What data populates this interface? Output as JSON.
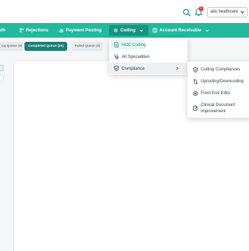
{
  "header": {
    "tenant_selected": "abc healthcare",
    "notification_count": "1"
  },
  "nav": {
    "items": [
      {
        "label": "uth"
      },
      {
        "label": "Rejections"
      },
      {
        "label": "Payment Posting"
      },
      {
        "label": "Coding"
      },
      {
        "label": "Account Receivable"
      }
    ]
  },
  "subtabs": {
    "items": [
      {
        "label": "ing Queue (0)"
      },
      {
        "label": "Completed Queue (20)"
      },
      {
        "label": "Failed Queue (0)"
      }
    ]
  },
  "coding_menu": {
    "items": [
      {
        "label": "HCC Coding"
      },
      {
        "label": "All Specialities"
      },
      {
        "label": "Compliance"
      }
    ]
  },
  "compliance_menu": {
    "items": [
      {
        "label": "Coding Compliances"
      },
      {
        "label": "Upcoding/Downcoding"
      },
      {
        "label": "Front End Edits"
      },
      {
        "label": "Clinical Document Improvement"
      }
    ]
  },
  "colors": {
    "nav_bg": "#22b99e",
    "nav_active": "#179480",
    "pill_dark": "#1e7e73",
    "accent_text": "#1a8f7d",
    "badge": "#e53935"
  }
}
